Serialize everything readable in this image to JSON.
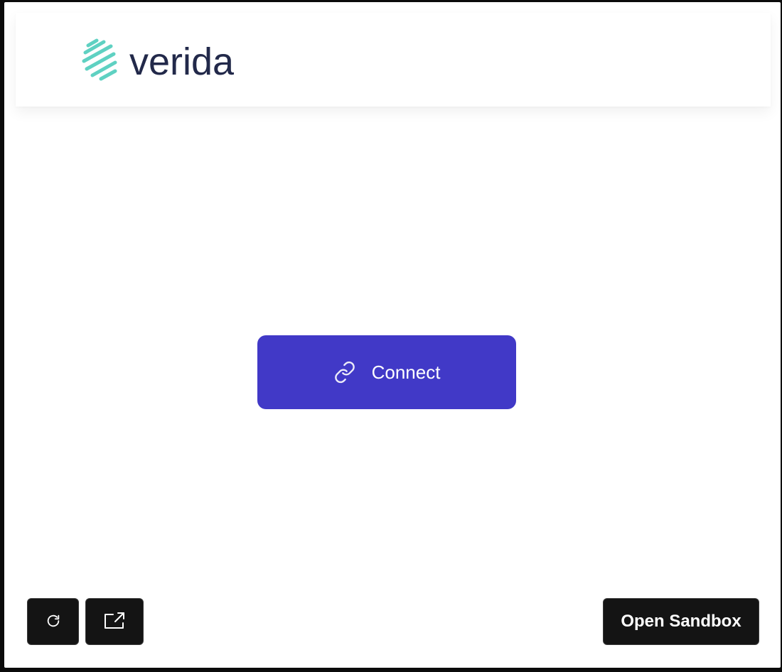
{
  "brand": {
    "name": "verida",
    "logo_colors": {
      "mark": "#5fd1c2",
      "text": "#22294a"
    }
  },
  "main": {
    "connect_button": {
      "label": "Connect",
      "icon": "link-icon",
      "color": "#4139c7"
    }
  },
  "footer": {
    "refresh_button": {
      "icon": "refresh-icon"
    },
    "popout_button": {
      "icon": "external-link-icon"
    },
    "sandbox_button": {
      "label": "Open Sandbox"
    }
  }
}
